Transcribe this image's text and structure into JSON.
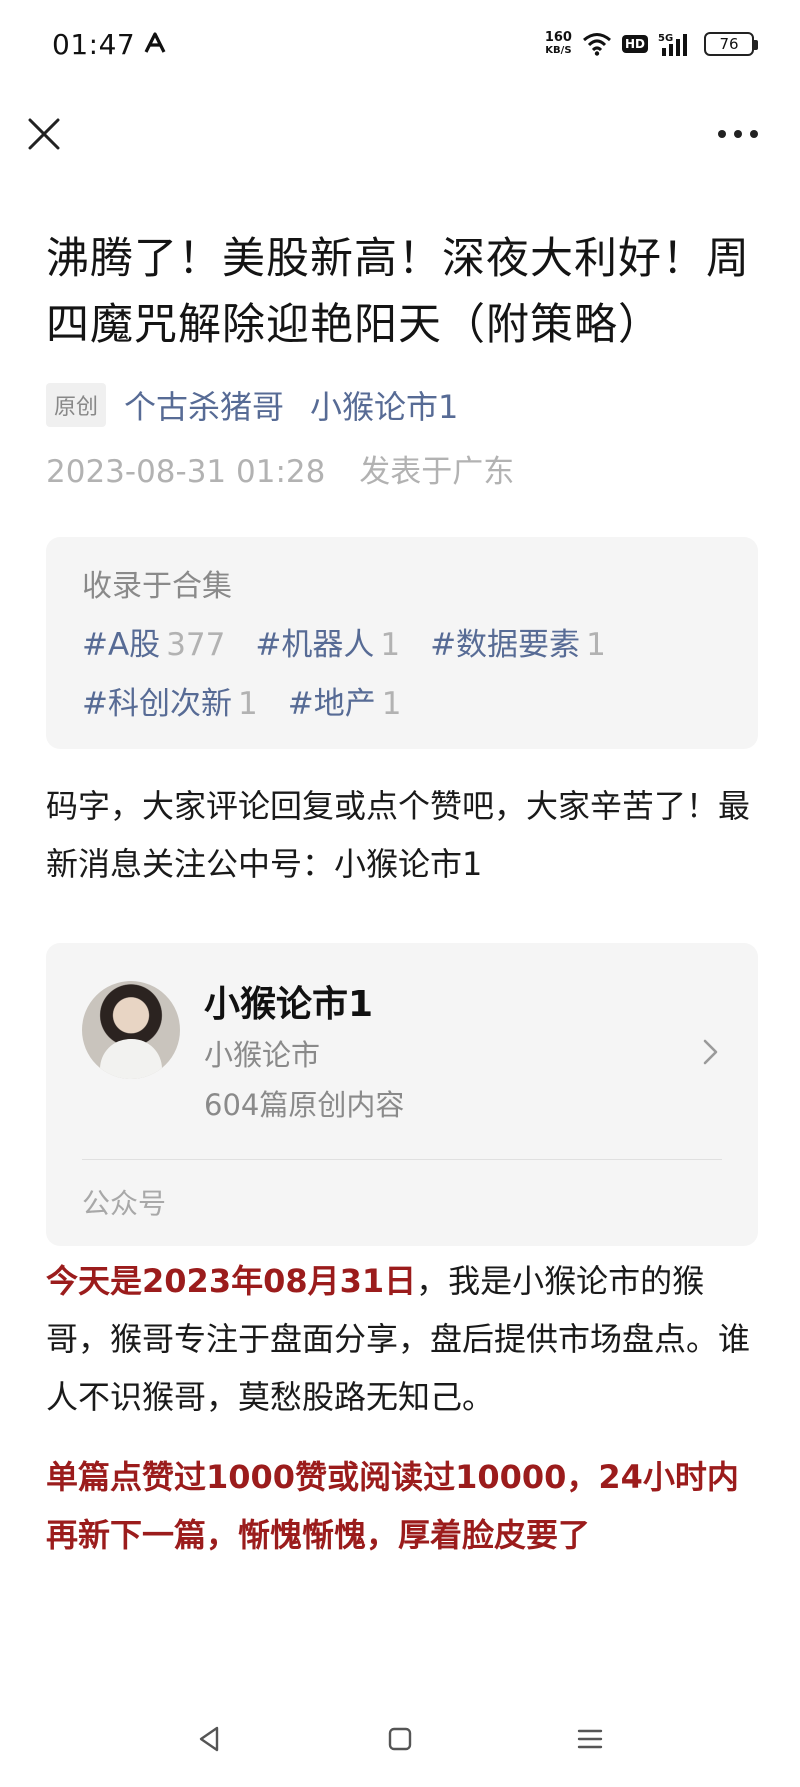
{
  "status_bar": {
    "time": "01:47",
    "net_speed_value": "160",
    "net_speed_unit": "KB/S",
    "hd_label": "HD",
    "signal_label": "5G",
    "battery": "76"
  },
  "article": {
    "title": "沸腾了！美股新高！深夜大利好！周四魔咒解除迎艳阳天（附策略）",
    "original_tag": "原创",
    "author": "个古杀猪哥",
    "account_link": "小猴论市1",
    "date": "2023-08-31 01:28",
    "location": "发表于广东"
  },
  "collection": {
    "title": "收录于合集",
    "tags": [
      {
        "label": "#A股",
        "count": "377"
      },
      {
        "label": "#机器人",
        "count": "1"
      },
      {
        "label": "#数据要素",
        "count": "1"
      },
      {
        "label": "#科创次新",
        "count": "1"
      },
      {
        "label": "#地产",
        "count": "1"
      }
    ]
  },
  "intro": "码字，大家评论回复或点个赞吧，大家辛苦了！最新消息关注公中号：小猴论市1",
  "account_card": {
    "name": "小猴论市1",
    "desc": "小猴论市",
    "count": "604篇原创内容",
    "footer": "公众号"
  },
  "body": {
    "p1_prefix": "今天是",
    "p1_date": "2023年08月31日",
    "p1_rest": "，我是小猴论市的猴哥，猴哥专注于盘面分享，盘后提供市场盘点。谁人不识猴哥，莫愁股路无知己。",
    "p2": "单篇点赞过1000赞或阅读过10000，24小时内再新下一篇，惭愧惭愧，厚着脸皮要了"
  },
  "colors": {
    "link": "#576b95",
    "accent_red": "#9b1c1c",
    "card_bg": "#f5f5f5"
  }
}
